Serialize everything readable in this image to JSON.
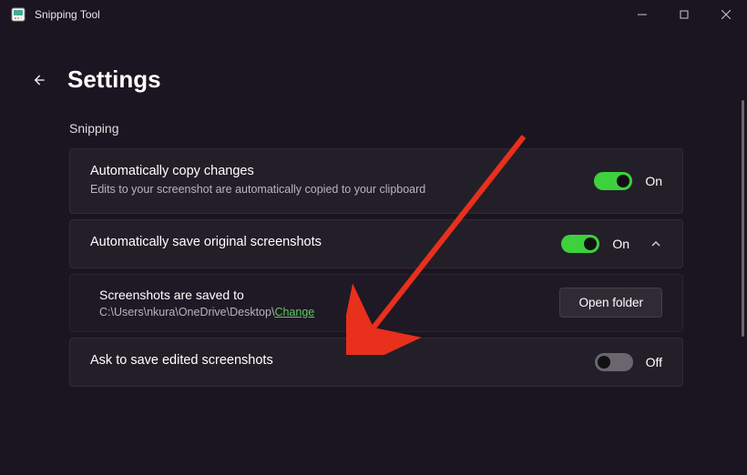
{
  "app": {
    "name": "Snipping Tool"
  },
  "page": {
    "title": "Settings",
    "section": "Snipping"
  },
  "settings": {
    "autoCopy": {
      "title": "Automatically copy changes",
      "subtitle": "Edits to your screenshot are automatically copied to your clipboard",
      "stateLabel": "On"
    },
    "autoSave": {
      "title": "Automatically save original screenshots",
      "stateLabel": "On"
    },
    "saveLocation": {
      "title": "Screenshots are saved to",
      "path": "C:\\Users\\nkura\\OneDrive\\Desktop\\",
      "changeLabel": "Change",
      "openFolderLabel": "Open folder"
    },
    "askToSave": {
      "title": "Ask to save edited screenshots",
      "stateLabel": "Off"
    }
  }
}
